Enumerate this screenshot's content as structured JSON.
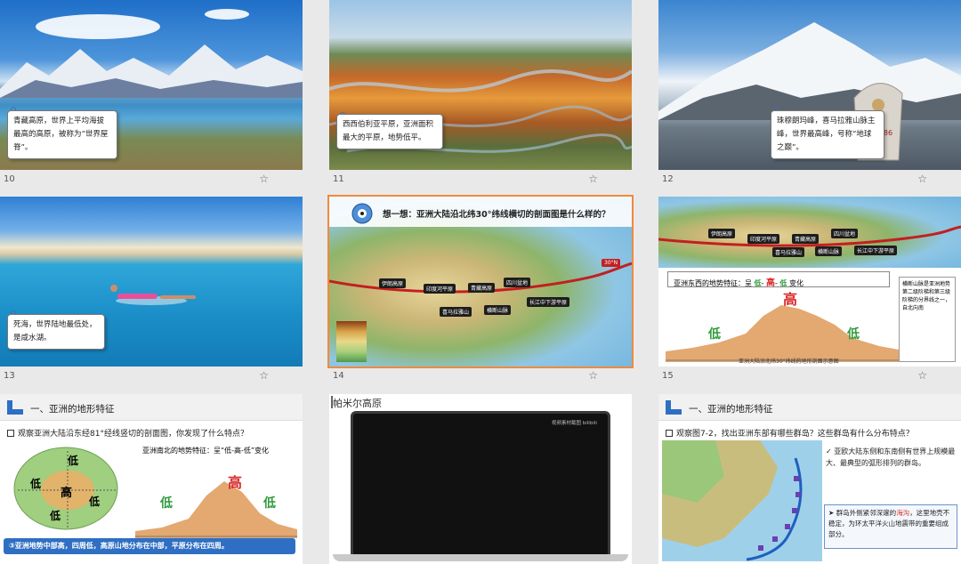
{
  "slides": [
    {
      "num": "10",
      "caption": "青藏高原，世界上平均海拔最高的高原，被称为“世界屋脊”。"
    },
    {
      "num": "11",
      "caption": "西西伯利亚平原，亚洲面积最大的平原，地势低平。"
    },
    {
      "num": "12",
      "caption": "珠穆朗玛峰，喜马拉雅山脉主峰，世界最高峰，号称“地球之巅”。"
    },
    {
      "num": "13",
      "caption": "死海，世界陆地最低处，是咸水湖。"
    },
    {
      "num": "14",
      "title": "想一想：亚洲大陆沿北纬30°纬线横切的剖面图是什么样的？",
      "latitude": "30°N",
      "tags": [
        "伊朗高原",
        "印度河平原",
        "青藏高原",
        "四川盆地",
        "喜马拉雅山",
        "横断山脉",
        "长江中下游平原"
      ]
    },
    {
      "num": "15",
      "tags": [
        "伊朗高原",
        "印度河平原",
        "青藏高原",
        "四川盆地",
        "喜马拉雅山",
        "横断山脉",
        "长江中下游平原"
      ],
      "feature_prefix": "亚洲东西的地势特征：呈",
      "feature_low1": "低",
      "feature_high": "高",
      "feature_low2": "低",
      "feature_suffix": "变化",
      "side_note": "横断山脉是亚洲地势第二级阶梯和第三级阶梯的分界线之一，自北向南",
      "profile_label_high": "高",
      "profile_label_low1": "低",
      "profile_label_low2": "低",
      "profile_caption": "亚洲大陆沿北纬30°纬线的地形剖面示意图"
    },
    {
      "num": "",
      "section": "一、亚洲的地形特征",
      "question": "观察亚洲大陆沿东经81°经线竖切的剖面图，你发现了什么特点？",
      "feature": "亚洲南北的地势特征：呈“低-高-低”变化",
      "map_labels": [
        "低",
        "低",
        "高",
        "低",
        "低"
      ],
      "profile_high": "高",
      "profile_low1": "低",
      "profile_low2": "低",
      "conclusion": "③亚洲地势中部高，四周低，高原山地分布在中部，平原分布在四周。"
    },
    {
      "num": "",
      "title": "帕米尔高原",
      "video_brand": "视频素材截图 bilibili"
    },
    {
      "num": "",
      "section": "一、亚洲的地形特征",
      "question": "观察图7-2，找出亚洲东部有哪些群岛？这些群岛有什么分布特点？",
      "point1": "亚欧大陆东侧和东南侧有世界上规模最大、最典型的弧形排列的群岛。",
      "point1_highlight": "弧形排列的群岛。",
      "point2_a": "群岛外侧紧邻深邃的",
      "point2_b": "海沟",
      "point2_c": "，这里地壳不稳定，为环太平洋火山地震带的重要组成部分。"
    }
  ],
  "colors": {
    "selected_outline": "#f08a3c",
    "accent_blue": "#2f6fc3",
    "accent_red": "#d92b2b",
    "accent_green": "#2e9a3a"
  }
}
